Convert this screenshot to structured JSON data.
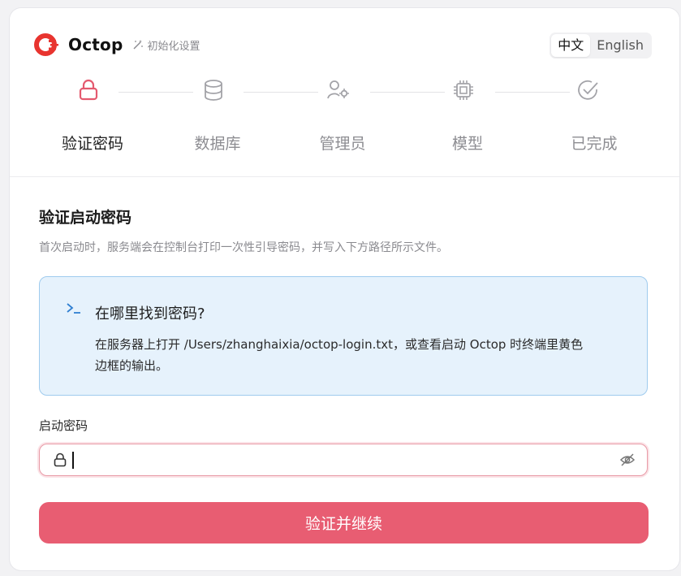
{
  "app": {
    "name": "Octop",
    "subtitle": "初始化设置"
  },
  "language": {
    "options": [
      "中文",
      "English"
    ],
    "selected": "中文"
  },
  "steps": [
    {
      "label": "验证密码",
      "icon": "lock-icon",
      "active": true
    },
    {
      "label": "数据库",
      "icon": "database-icon",
      "active": false
    },
    {
      "label": "管理员",
      "icon": "admin-user-gear-icon",
      "active": false
    },
    {
      "label": "模型",
      "icon": "chip-icon",
      "active": false
    },
    {
      "label": "已完成",
      "icon": "check-circle-icon",
      "active": false
    }
  ],
  "section": {
    "title": "验证启动密码",
    "description": "首次启动时，服务端会在控制台打印一次性引导密码，并写入下方路径所示文件。"
  },
  "info": {
    "icon": "terminal-prompt-icon",
    "title": "在哪里找到密码?",
    "body_line1": "在服务器上打开 /Users/zhanghaixia/octop-login.txt，或查看启动 Octop 时终端里黄色",
    "body_line2": "边框的输出。"
  },
  "form": {
    "password_label": "启动密码",
    "password_value": "",
    "submit_label": "验证并继续"
  },
  "colors": {
    "accent": "#e85d72",
    "brand_red": "#e8342f",
    "info_bg": "#e6f2fc",
    "info_border": "#9fcbee"
  }
}
